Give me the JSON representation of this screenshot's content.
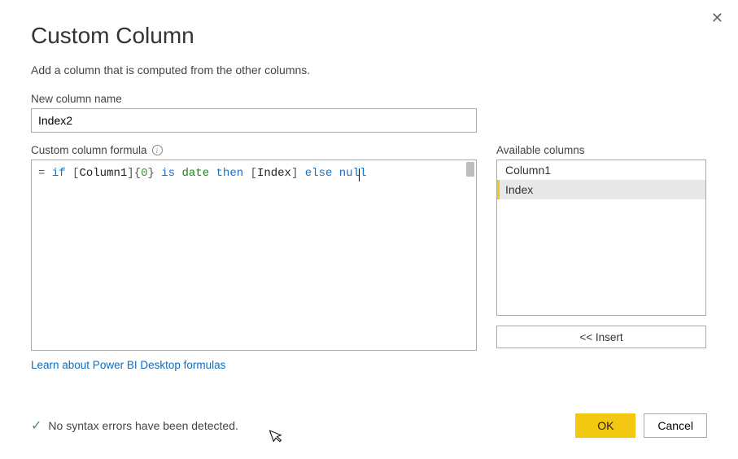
{
  "dialog": {
    "title": "Custom Column",
    "subtitle": "Add a column that is computed from the other columns.",
    "close_glyph": "✕"
  },
  "name_field": {
    "label": "New column name",
    "value": "Index2"
  },
  "formula": {
    "label": "Custom column formula",
    "prefix": "= ",
    "tokens": {
      "if": "if",
      "col1_open": "[",
      "col1": "Column1",
      "col1_close": "]",
      "brace_open": "{",
      "zero": "0",
      "brace_close": "}",
      "is": "is",
      "date": "date",
      "then": "then",
      "idx_open": "[",
      "idx": "Index",
      "idx_close": "]",
      "else": "else",
      "nul": "nul",
      "l": "l"
    }
  },
  "learn_link": "Learn about Power BI Desktop formulas",
  "available": {
    "label": "Available columns",
    "items": [
      "Column1",
      "Index"
    ],
    "selected_index": 1,
    "insert_label": "<< Insert"
  },
  "status": {
    "check_glyph": "✓",
    "message": "No syntax errors have been detected."
  },
  "buttons": {
    "ok": "OK",
    "cancel": "Cancel"
  }
}
